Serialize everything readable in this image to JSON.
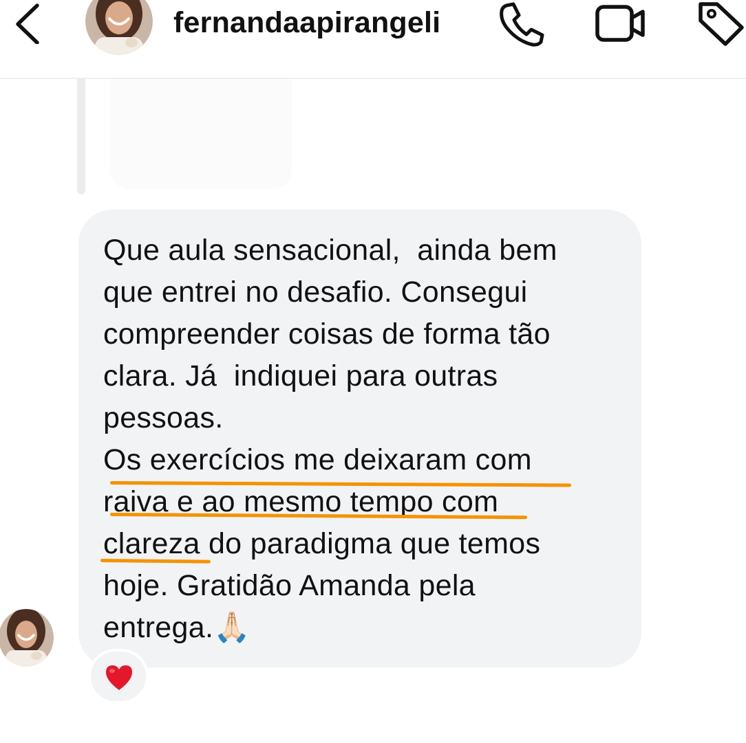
{
  "header": {
    "username": "fernandaapirangeli",
    "back_icon": "chevron-left-icon",
    "phone_icon": "phone-icon",
    "video_icon": "video-camera-icon",
    "tag_icon": "tag-icon"
  },
  "message": {
    "text": "Que aula sensacional,  ainda bem\nque entrei no desafio. Consegui\ncompreender coisas de forma tão\nclara. Já  indiquei para outras\npessoas.\nOs exercícios me deixaram com\nraiva e ao mesmo tempo com\nclareza do paradigma que temos\nhoje. Gratidão Amanda pela\nentrega.🙏🏻",
    "reaction": "❤️"
  },
  "colors": {
    "bubble": "#f2f3f5",
    "highlight": "#f59300",
    "text": "#111111"
  }
}
